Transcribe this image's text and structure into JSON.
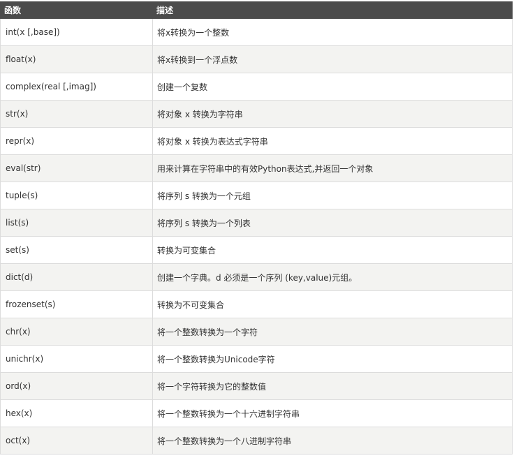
{
  "table": {
    "headers": {
      "function": "函数",
      "description": "描述"
    },
    "rows": [
      {
        "function": "int(x [,base])",
        "description": "将x转换为一个整数"
      },
      {
        "function": "float(x)",
        "description": "将x转换到一个浮点数"
      },
      {
        "function": "complex(real [,imag])",
        "description": "创建一个复数"
      },
      {
        "function": "str(x)",
        "description": "将对象 x 转换为字符串"
      },
      {
        "function": "repr(x)",
        "description": "将对象 x 转换为表达式字符串"
      },
      {
        "function": "eval(str)",
        "description": "用来计算在字符串中的有效Python表达式,并返回一个对象"
      },
      {
        "function": "tuple(s)",
        "description": "将序列 s 转换为一个元组"
      },
      {
        "function": "list(s)",
        "description": "将序列 s 转换为一个列表"
      },
      {
        "function": "set(s)",
        "description": "转换为可变集合"
      },
      {
        "function": "dict(d)",
        "description": "创建一个字典。d 必须是一个序列 (key,value)元组。"
      },
      {
        "function": "frozenset(s)",
        "description": "转换为不可变集合"
      },
      {
        "function": "chr(x)",
        "description": "将一个整数转换为一个字符"
      },
      {
        "function": "unichr(x)",
        "description": "将一个整数转换为Unicode字符"
      },
      {
        "function": "ord(x)",
        "description": "将一个字符转换为它的整数值"
      },
      {
        "function": "hex(x)",
        "description": "将一个整数转换为一个十六进制字符串"
      },
      {
        "function": "oct(x)",
        "description": "将一个整数转换为一个八进制字符串"
      }
    ]
  },
  "colors": {
    "header_background": "#4b4b4b",
    "header_text": "#ffffff",
    "row_odd": "#ffffff",
    "row_even": "#f3f3f1",
    "border": "#dcdcdc",
    "text": "#333333"
  }
}
